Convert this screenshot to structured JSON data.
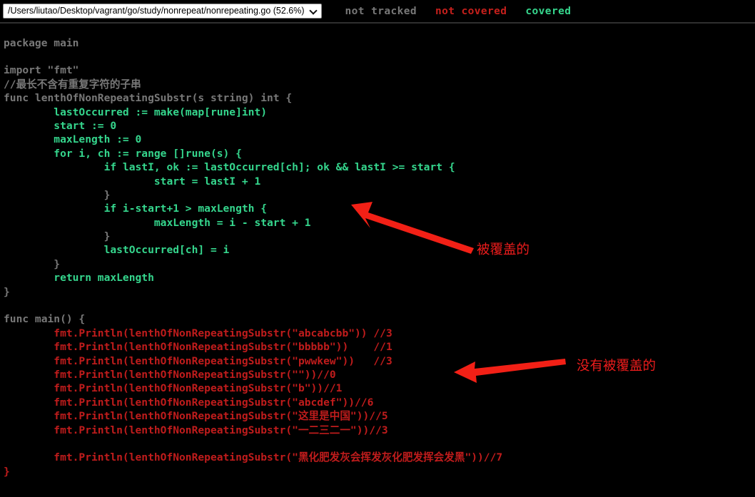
{
  "window": {
    "background": "#000000",
    "title": "Go coverage report"
  },
  "toolbar": {
    "file_select": {
      "value": "/Users/liutao/Desktop/vagrant/go/study/nonrepeat/nonrepeating.go (52.6%)",
      "chevron_icon": "chevron-down-icon",
      "options": [
        "/Users/liutao/Desktop/vagrant/go/study/nonrepeat/nonrepeating.go (52.6%)"
      ]
    },
    "legend": [
      {
        "label": "not tracked",
        "color": "#787878"
      },
      {
        "label": "not covered",
        "color": "#c6201c"
      },
      {
        "label": "covered",
        "color": "#36d68d"
      }
    ]
  },
  "code": {
    "colors": {
      "not_tracked": "#787878",
      "not_covered": "#c01c1c",
      "covered": "#35d68d"
    },
    "lines": [
      {
        "text": "package main",
        "cov": "nottracked"
      },
      {
        "text": "",
        "cov": "nottracked"
      },
      {
        "text": "import \"fmt\"",
        "cov": "nottracked"
      },
      {
        "text": "//最长不含有重复字符的子串",
        "cov": "nottracked"
      },
      {
        "text": "func lenthOfNonRepeatingSubstr(s string) int {",
        "cov": "nottracked"
      },
      {
        "text": "        lastOccurred := make(map[rune]int)",
        "cov": "covered"
      },
      {
        "text": "        start := 0",
        "cov": "covered"
      },
      {
        "text": "        maxLength := 0",
        "cov": "covered"
      },
      {
        "text": "        for i, ch := range []rune(s) {",
        "cov": "covered"
      },
      {
        "text": "                if lastI, ok := lastOccurred[ch]; ok && lastI >= start {",
        "cov": "covered"
      },
      {
        "text": "                        start = lastI + 1",
        "cov": "covered"
      },
      {
        "text": "                }",
        "cov": "nottracked"
      },
      {
        "text": "                if i-start+1 > maxLength {",
        "cov": "covered"
      },
      {
        "text": "                        maxLength = i - start + 1",
        "cov": "covered"
      },
      {
        "text": "                }",
        "cov": "nottracked"
      },
      {
        "text": "                lastOccurred[ch] = i",
        "cov": "covered"
      },
      {
        "text": "        }",
        "cov": "nottracked"
      },
      {
        "text": "        return maxLength",
        "cov": "covered"
      },
      {
        "text": "}",
        "cov": "nottracked"
      },
      {
        "text": "",
        "cov": "nottracked"
      },
      {
        "text": "func main() {",
        "cov": "nottracked"
      },
      {
        "text": "        fmt.Println(lenthOfNonRepeatingSubstr(\"abcabcbb\")) //3",
        "cov": "notcovered"
      },
      {
        "text": "        fmt.Println(lenthOfNonRepeatingSubstr(\"bbbbb\"))    //1",
        "cov": "notcovered"
      },
      {
        "text": "        fmt.Println(lenthOfNonRepeatingSubstr(\"pwwkew\"))   //3",
        "cov": "notcovered"
      },
      {
        "text": "        fmt.Println(lenthOfNonRepeatingSubstr(\"\"))//0",
        "cov": "notcovered"
      },
      {
        "text": "        fmt.Println(lenthOfNonRepeatingSubstr(\"b\"))//1",
        "cov": "notcovered"
      },
      {
        "text": "        fmt.Println(lenthOfNonRepeatingSubstr(\"abcdef\"))//6",
        "cov": "notcovered"
      },
      {
        "text": "        fmt.Println(lenthOfNonRepeatingSubstr(\"这里是中国\"))//5",
        "cov": "notcovered"
      },
      {
        "text": "        fmt.Println(lenthOfNonRepeatingSubstr(\"一二三二一\"))//3",
        "cov": "notcovered"
      },
      {
        "text": "",
        "cov": "notcovered"
      },
      {
        "text": "        fmt.Println(lenthOfNonRepeatingSubstr(\"黑化肥发灰会挥发灰化肥发挥会发黑\"))//7",
        "cov": "notcovered"
      },
      {
        "text": "}",
        "cov": "notcovered"
      }
    ]
  },
  "annotations": [
    {
      "label": "被覆盖的",
      "color": "#ed1c1c",
      "arrow": "arrow-pointing-up-left"
    },
    {
      "label": "没有被覆盖的",
      "color": "#ed1c1c",
      "arrow": "arrow-pointing-left"
    }
  ]
}
